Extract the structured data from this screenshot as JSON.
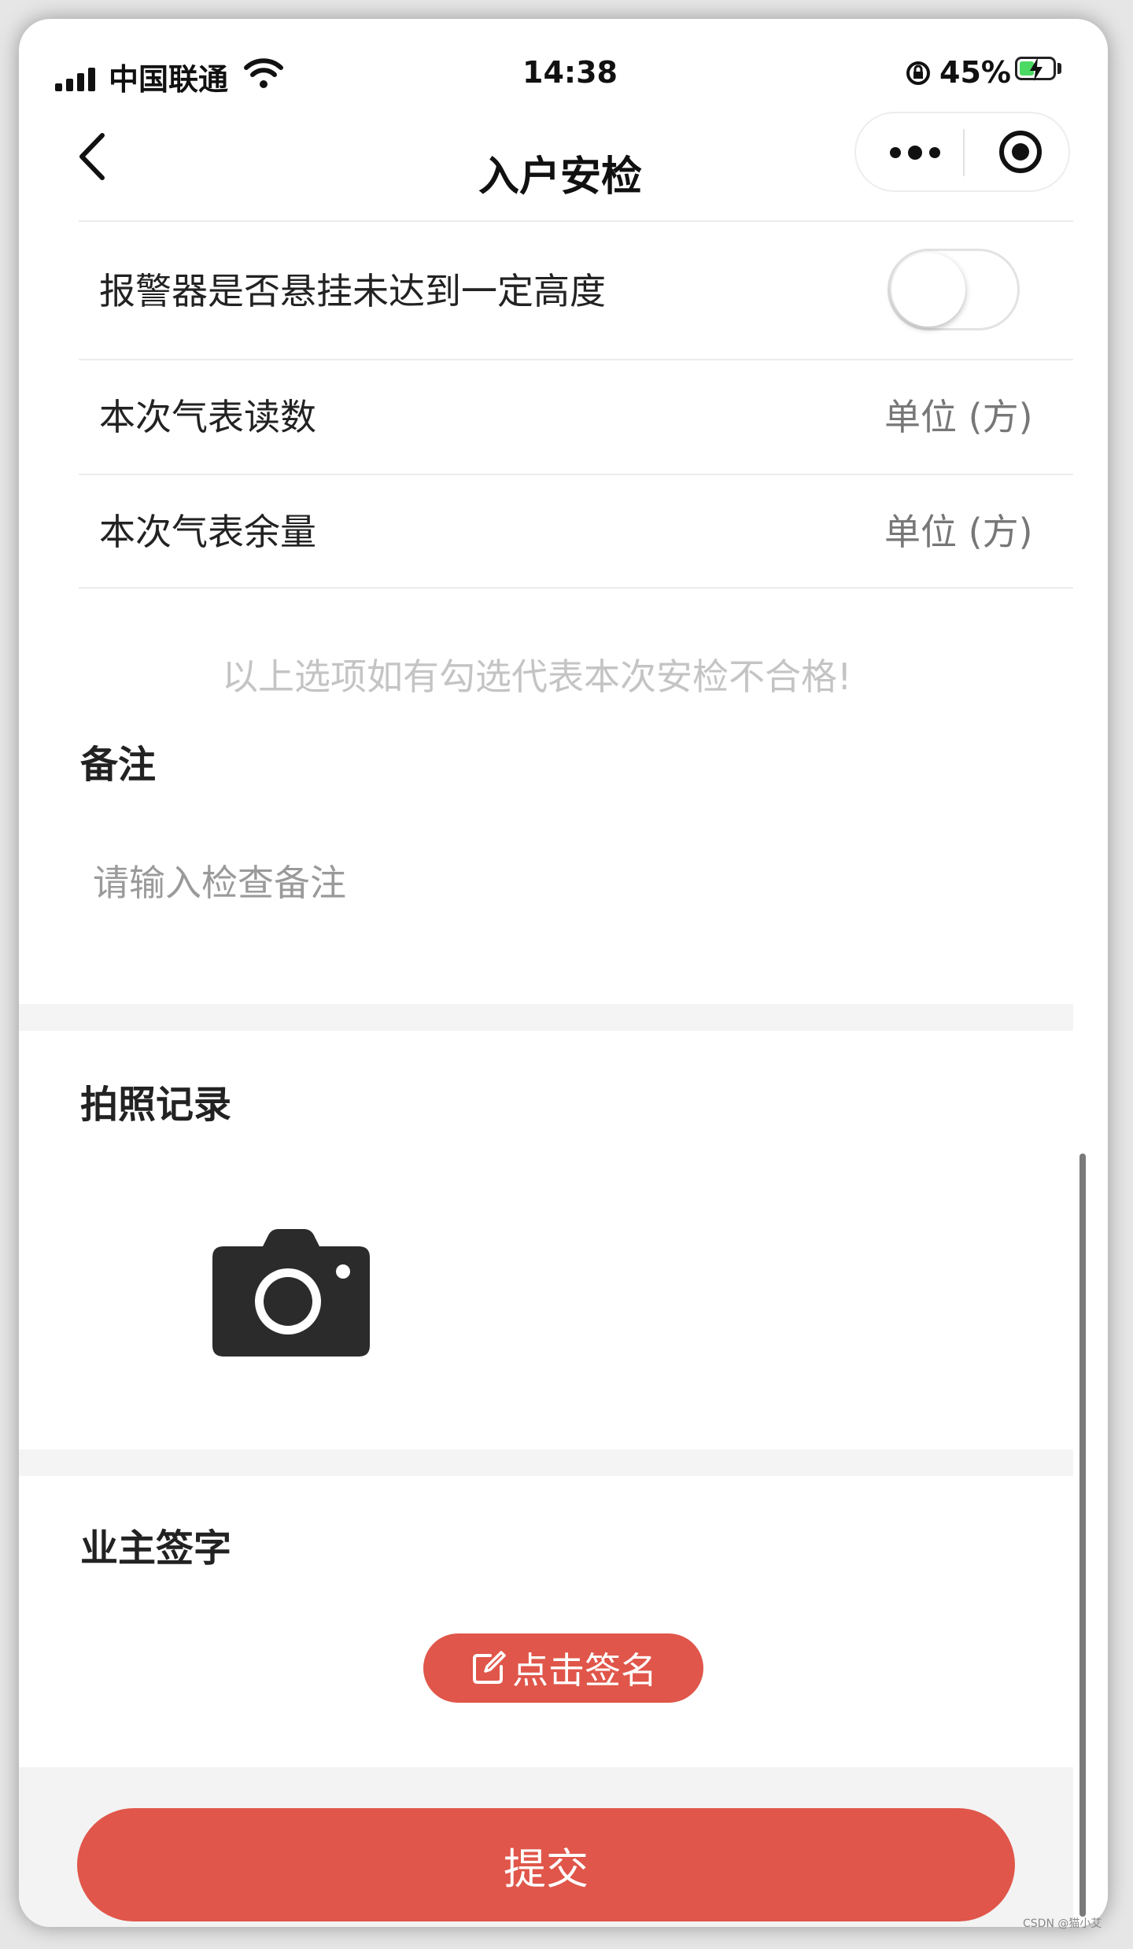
{
  "status_bar": {
    "carrier": "中国联通",
    "time": "14:38",
    "battery_percent": "45%",
    "battery_level": 0.45,
    "icons": [
      "signal-icon",
      "wifi-icon",
      "rotation-lock-icon",
      "battery-charging-icon"
    ]
  },
  "nav": {
    "title": "入户安检",
    "back_icon": "chevron-left-icon",
    "more_icon": "more-dots-icon",
    "close_icon": "target-circle-icon"
  },
  "form": {
    "rows": [
      {
        "label": "报警器是否悬挂未达到一定高度",
        "type": "toggle",
        "checked": false
      },
      {
        "label": "本次气表读数",
        "value_placeholder": "单位 (方)"
      },
      {
        "label": "本次气表余量",
        "value_placeholder": "单位 (方)"
      }
    ],
    "hint": "以上选项如有勾选代表本次安检不合格!"
  },
  "remark": {
    "title": "备注",
    "placeholder": "请输入检查备注"
  },
  "photo": {
    "title": "拍照记录",
    "icon": "camera-icon"
  },
  "signature": {
    "title": "业主签字",
    "button_label": "点击签名",
    "button_icon": "edit-icon"
  },
  "submit": {
    "label": "提交"
  },
  "watermark": "CSDN @猫小艾",
  "colors": {
    "accent": "#e0564a",
    "background": "#ffffff",
    "band": "#f4f4f4"
  }
}
